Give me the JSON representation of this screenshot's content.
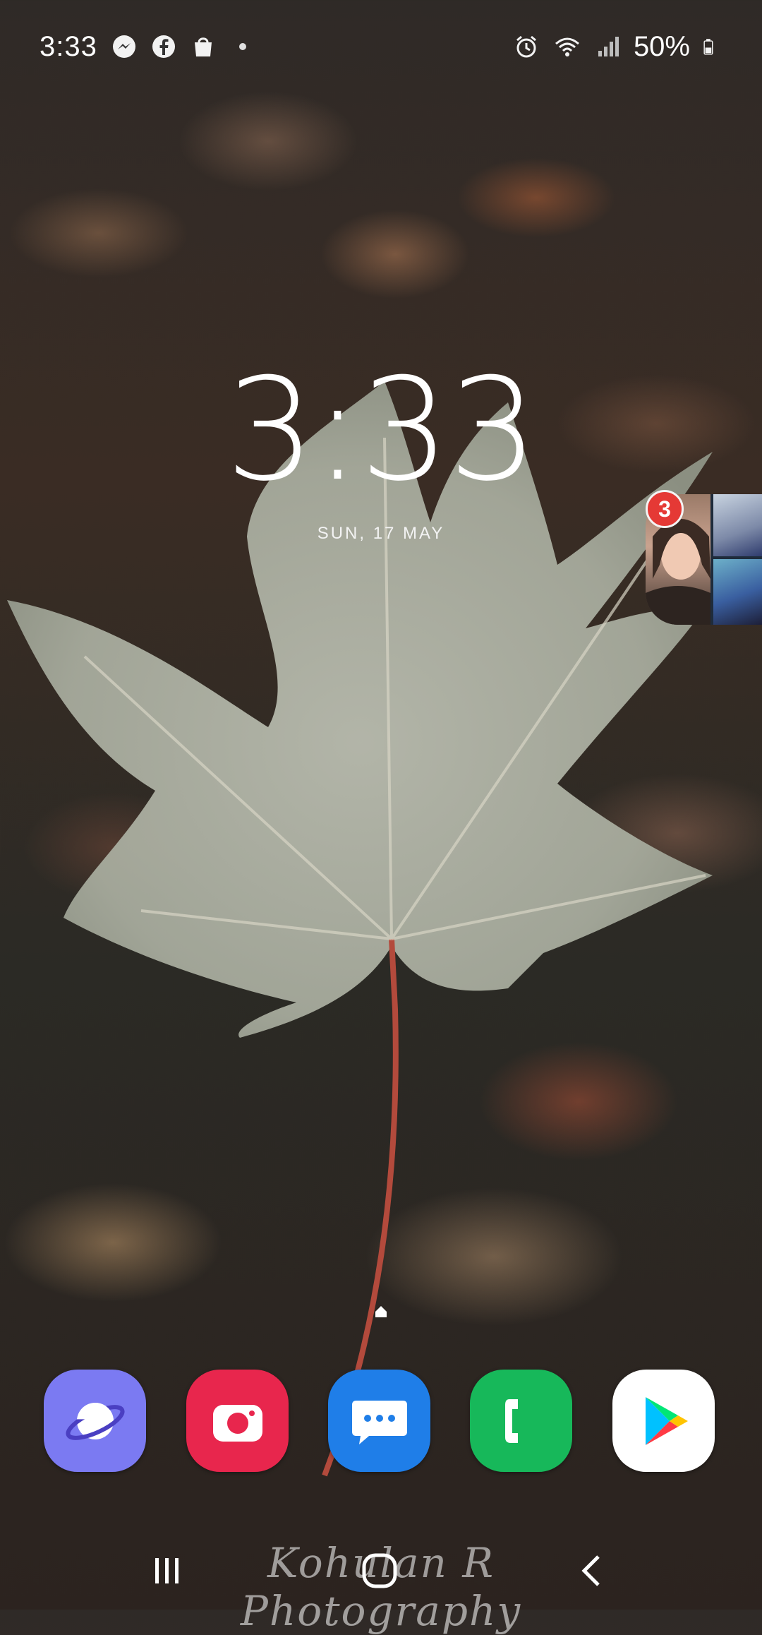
{
  "status_bar": {
    "time": "3:33",
    "notification_icons": [
      "messenger-icon",
      "facebook-icon",
      "shopping-bag-icon",
      "dot-icon"
    ],
    "system_icons": [
      "alarm-icon",
      "wifi-icon",
      "signal-icon"
    ],
    "battery_percent": "50%"
  },
  "lockscreen": {
    "clock": "3:33",
    "date": "SUN, 17 MAY"
  },
  "chat_head": {
    "unread_count": "3"
  },
  "dock": {
    "apps": [
      {
        "name": "Internet",
        "icon": "planet-icon",
        "color": "#7b7af2"
      },
      {
        "name": "Camera",
        "icon": "camera-icon",
        "color": "#e8264d"
      },
      {
        "name": "Messages",
        "icon": "chat-bubble-icon",
        "color": "#1f7ee8"
      },
      {
        "name": "Phone",
        "icon": "phone-icon",
        "color": "#17b85a"
      },
      {
        "name": "Play Store",
        "icon": "play-store-icon",
        "color": "#ffffff"
      }
    ]
  },
  "navigation": {
    "buttons": [
      "recents-icon",
      "home-icon",
      "back-icon"
    ]
  },
  "wallpaper": {
    "watermark": "Kohulan R Photography"
  }
}
